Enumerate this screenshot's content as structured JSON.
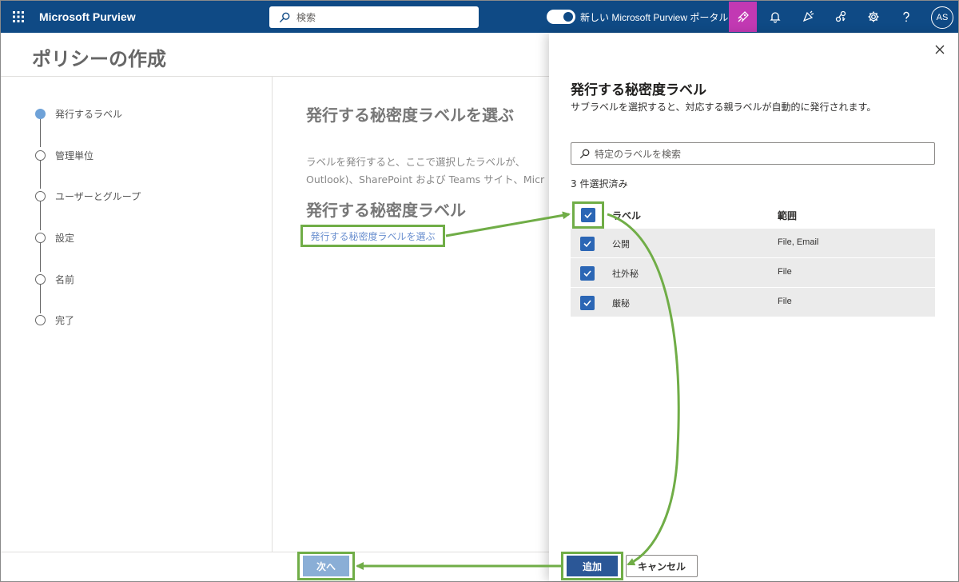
{
  "topbar": {
    "brand": "Microsoft Purview",
    "search_placeholder": "検索",
    "toggle_label": "新しい Microsoft Purview ポータル",
    "avatar_initials": "AS",
    "icons": [
      "rocket-icon",
      "bell-icon",
      "megaphone-icon",
      "share-icon",
      "gear-icon",
      "help-icon"
    ],
    "active_color": "#c239b3",
    "bar_color": "#0f4a85"
  },
  "page": {
    "title": "ポリシーの作成",
    "steps": [
      {
        "label": "発行するラベル",
        "active": true
      },
      {
        "label": "管理単位",
        "active": false
      },
      {
        "label": "ユーザーとグループ",
        "active": false
      },
      {
        "label": "設定",
        "active": false
      },
      {
        "label": "名前",
        "active": false
      },
      {
        "label": "完了",
        "active": false
      }
    ],
    "heading": "発行する秘密度ラベルを選ぶ",
    "desc_line1": "ラベルを発行すると、ここで選択したラベルが、",
    "desc_line2": "Outlook)、SharePoint および Teams サイト、Micr",
    "subheading": "発行する秘密度ラベル",
    "choose_link": "発行する秘密度ラベルを選ぶ",
    "next_button": "次へ"
  },
  "panel": {
    "title": "発行する秘密度ラベル",
    "subtitle": "サブラベルを選択すると、対応する親ラベルが自動的に発行されます。",
    "search_placeholder": "特定のラベルを検索",
    "selected_count": "3 件選択済み",
    "col_label": "ラベル",
    "col_scope": "範囲",
    "rows": [
      {
        "name": "公開",
        "scope": "File, Email",
        "checked": true
      },
      {
        "name": "社外秘",
        "scope": "File",
        "checked": true
      },
      {
        "name": "厳秘",
        "scope": "File",
        "checked": true
      }
    ],
    "add_button": "追加",
    "cancel_button": "キャンセル"
  },
  "annotation_color": "#70ad47"
}
